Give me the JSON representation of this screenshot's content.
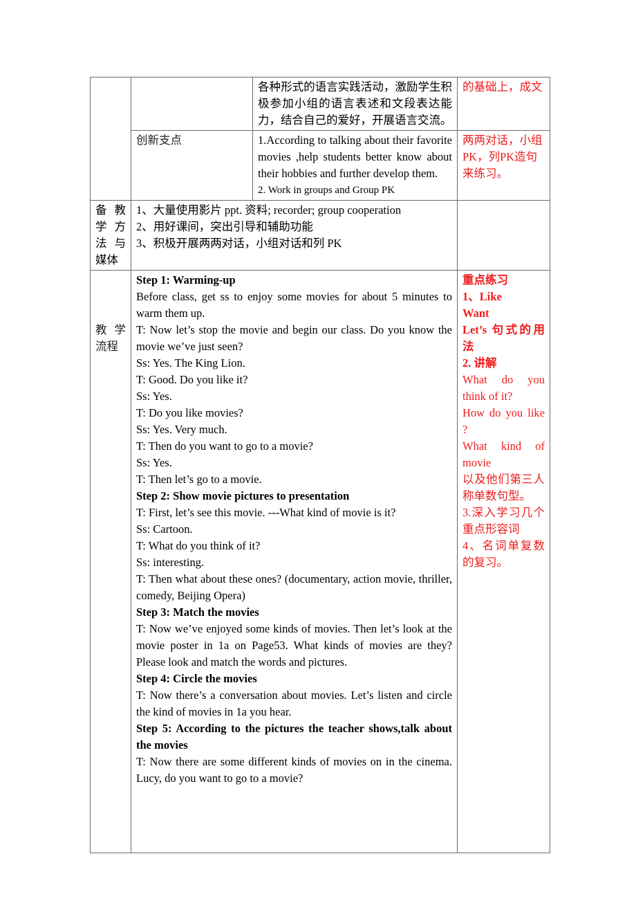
{
  "table": {
    "row1": {
      "col3_text": "各种形式的语言实践活动，激励学生积极参加小组的语言表述和文段表达能力，结合自己的爱好，开展语言交流。",
      "col4_text": "的基础上，成文"
    },
    "row2": {
      "label": "创新支点",
      "points": [
        "1.According to talking about their favorite movies ,help students better know about their hobbies and further develop them.",
        "2. Work in groups and Group PK"
      ],
      "note": "两两对话，小组PK，列PK造句来练习。"
    },
    "row3": {
      "label_lines": [
        "备 教",
        "学 方",
        "法 与",
        "媒体"
      ],
      "items": [
        "1、大量使用影片 ppt. 资料; recorder; group cooperation",
        "2、用好课间，突出引导和辅助功能",
        "3、积极开展两两对话，小组对话和列 PK"
      ]
    },
    "row4": {
      "label_lines": [
        "教 学",
        "流程"
      ],
      "content": [
        {
          "type": "heading",
          "text": "Step 1: Warming-up"
        },
        {
          "type": "para",
          "text": "Before class, get ss to enjoy some movies for about 5 minutes to warm them up."
        },
        {
          "type": "para",
          "text": "T: Now let’s stop the movie and begin our class. Do you know the movie we’ve just seen?"
        },
        {
          "type": "para",
          "text": "Ss: Yes. The King Lion."
        },
        {
          "type": "para",
          "text": "T: Good. Do you like it?"
        },
        {
          "type": "para",
          "text": "Ss: Yes."
        },
        {
          "type": "para",
          "text": "T: Do you like movies?"
        },
        {
          "type": "para",
          "text": "Ss: Yes. Very much."
        },
        {
          "type": "para",
          "text": "T: Then do you want to go to a movie?"
        },
        {
          "type": "para",
          "text": "Ss: Yes."
        },
        {
          "type": "para",
          "text": "T: Then let’s go to a movie."
        },
        {
          "type": "heading",
          "text": "Step 2: Show movie pictures to presentation"
        },
        {
          "type": "para",
          "text": "T: First, let’s see this movie. ---What kind of movie is it?"
        },
        {
          "type": "para",
          "text": "Ss: Cartoon."
        },
        {
          "type": "para",
          "text": "T: What do you think of it?"
        },
        {
          "type": "para",
          "text": "Ss: interesting."
        },
        {
          "type": "para",
          "text": "T: Then what about these ones? (documentary, action movie, thriller, comedy, Beijing Opera)"
        },
        {
          "type": "heading",
          "text": "Step 3: Match the movies"
        },
        {
          "type": "para",
          "text": "T: Now we’ve enjoyed some kinds of movies. Then let’s look at the movie poster in 1a on Page53. What kinds of movies are they? Please look and match the words and pictures."
        },
        {
          "type": "heading",
          "text": "Step 4: Circle the movies"
        },
        {
          "type": "para",
          "text": "T: Now there’s a conversation about movies. Let’s listen and circle the kind of movies in 1a you hear."
        },
        {
          "type": "heading",
          "text": "Step 5: According to the pictures the teacher shows,talk about the movies"
        },
        {
          "type": "para",
          "text": "T: Now there are some different kinds of movies on in the cinema. Lucy, do you want to go to a movie?"
        }
      ],
      "notes": [
        {
          "bold": true,
          "text": "重点练习"
        },
        {
          "bold": true,
          "text": "1、Like"
        },
        {
          "bold": true,
          "text": "Want"
        },
        {
          "bold": true,
          "text": "Let’s 句式的用法"
        },
        {
          "bold": true,
          "text": "2. 讲解"
        },
        {
          "bold": false,
          "text": "What do you think of it?"
        },
        {
          "bold": false,
          "text": "How do you like ?"
        },
        {
          "bold": false,
          "text": "What kind of movie"
        },
        {
          "bold": false,
          "text": "以及他们第三人称单数句型。"
        },
        {
          "bold": false,
          "text": "3.深入学习几个重点形容词"
        },
        {
          "bold": false,
          "text": "4、名词单复数的复习。"
        }
      ]
    }
  },
  "colors": {
    "note_red": "#ee1c1c",
    "border": "#6b6b6b",
    "text": "#000000"
  }
}
